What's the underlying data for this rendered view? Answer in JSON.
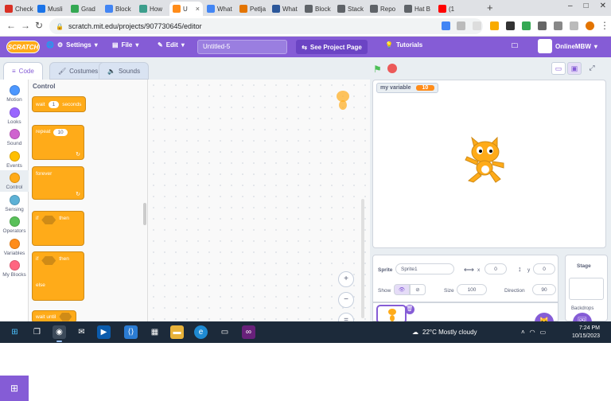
{
  "browser": {
    "tabs": [
      {
        "label": "Check",
        "color": "#d93025"
      },
      {
        "label": "Musli",
        "color": "#1a73e8"
      },
      {
        "label": "Grad",
        "color": "#34a853"
      },
      {
        "label": "Block",
        "color": "#4285f4"
      },
      {
        "label": "How",
        "color": "#3c9e8c"
      },
      {
        "label": "U",
        "color": "#ff8c1a"
      },
      {
        "label": "What",
        "color": "#4285f4"
      },
      {
        "label": "Petlja",
        "color": "#e37400"
      },
      {
        "label": "What",
        "color": "#2b579a"
      },
      {
        "label": "Block",
        "color": "#5f6368"
      },
      {
        "label": "Stack",
        "color": "#5f6368"
      },
      {
        "label": "Repo",
        "color": "#5f6368"
      },
      {
        "label": "Hat B",
        "color": "#5f6368"
      },
      {
        "label": "(1",
        "color": "#ff0000"
      }
    ],
    "active_tab_index": 5,
    "url": "scratch.mit.edu/projects/907730645/editor"
  },
  "menubar": {
    "logo_text": "SCRATCH",
    "settings": "Settings",
    "file": "File",
    "edit": "Edit",
    "project_title": "Untitled-5",
    "see_project_page": "See Project Page",
    "tutorials": "Tutorials",
    "username": "OnlineMBW"
  },
  "editor_tabs": {
    "code": "Code",
    "costumes": "Costumes",
    "sounds": "Sounds"
  },
  "categories": [
    {
      "label": "Motion",
      "color": "#4c97ff"
    },
    {
      "label": "Looks",
      "color": "#9966ff"
    },
    {
      "label": "Sound",
      "color": "#cf63cf"
    },
    {
      "label": "Events",
      "color": "#ffbf00"
    },
    {
      "label": "Control",
      "color": "#ffab19"
    },
    {
      "label": "Sensing",
      "color": "#5cb1d6"
    },
    {
      "label": "Operators",
      "color": "#59c059"
    },
    {
      "label": "Variables",
      "color": "#ff8c1a"
    },
    {
      "label": "My Blocks",
      "color": "#ff6680"
    }
  ],
  "palette": {
    "title": "Control",
    "wait_label": "wait",
    "wait_value": "1",
    "wait_unit": "seconds",
    "repeat_label": "repeat",
    "repeat_value": "10",
    "forever_label": "forever",
    "if_label": "if",
    "then_label": "then",
    "if2_label": "if",
    "then2_label": "then",
    "else_label": "else",
    "wait_until_label": "wait until"
  },
  "stage": {
    "monitor_name": "my variable",
    "monitor_value": "10"
  },
  "sprite_info": {
    "sprite_label": "Sprite",
    "sprite_name": "Sprite1",
    "x_label": "x",
    "x_value": "0",
    "y_label": "y",
    "y_value": "0",
    "show_label": "Show",
    "size_label": "Size",
    "size_value": "100",
    "direction_label": "Direction",
    "direction_value": "90"
  },
  "stage_panel": {
    "title": "Stage",
    "backdrops_label": "Backdrops"
  },
  "taskbar": {
    "weather": "22°C  Mostly cloudy",
    "time": "7:24 PM",
    "date": "10/15/2023"
  }
}
